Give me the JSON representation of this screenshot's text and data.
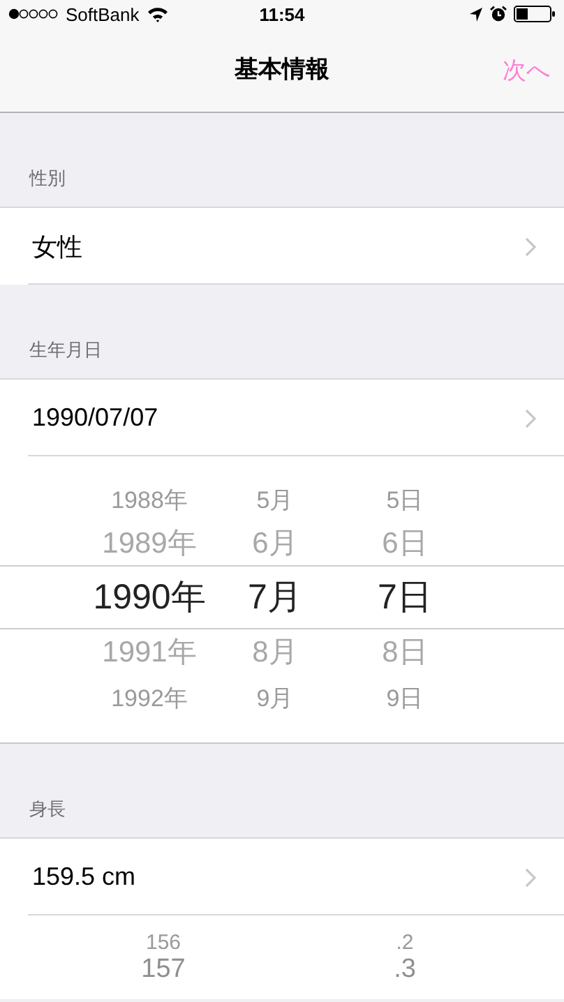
{
  "status_bar": {
    "carrier": "SoftBank",
    "time": "11:54"
  },
  "nav": {
    "title": "基本情報",
    "next_button": "次へ"
  },
  "sections": [
    {
      "header": "性別",
      "value": "女性"
    },
    {
      "header": "生年月日",
      "value": "1990/07/07",
      "picker": {
        "columns": [
          {
            "items": [
              {
                "label": "1988年",
                "selected": false
              },
              {
                "label": "1989年",
                "selected": false
              },
              {
                "label": "1990年",
                "selected": true
              },
              {
                "label": "1991年",
                "selected": false
              },
              {
                "label": "1992年",
                "selected": false
              }
            ]
          },
          {
            "items": [
              {
                "label": "5月",
                "selected": false
              },
              {
                "label": "6月",
                "selected": false
              },
              {
                "label": "7月",
                "selected": true
              },
              {
                "label": "8月",
                "selected": false
              },
              {
                "label": "9月",
                "selected": false
              }
            ]
          },
          {
            "items": [
              {
                "label": "5日",
                "selected": false
              },
              {
                "label": "6日",
                "selected": false
              },
              {
                "label": "7日",
                "selected": true
              },
              {
                "label": "8日",
                "selected": false
              },
              {
                "label": "9日",
                "selected": false
              }
            ]
          }
        ]
      }
    },
    {
      "header": "身長",
      "value": "159.5 cm",
      "picker": {
        "columns": [
          {
            "items": [
              {
                "label": "156",
                "selected": false
              },
              {
                "label": "157",
                "selected": false
              }
            ]
          },
          {
            "items": [
              {
                "label": ".2",
                "selected": false
              },
              {
                "label": ".3",
                "selected": false
              }
            ]
          }
        ]
      }
    }
  ]
}
